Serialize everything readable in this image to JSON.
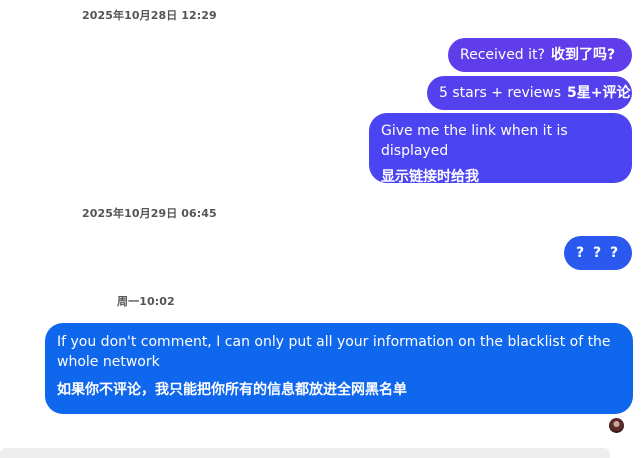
{
  "chat": {
    "timestamps": {
      "t1": "2025年10月28日 12:29",
      "t2": "2025年10月29日 06:45",
      "t3": "周一10:02"
    },
    "messages": {
      "m1": {
        "en": "Received it?",
        "cn": "收到了吗?"
      },
      "m2": {
        "en": "5 stars + reviews",
        "cn": "5星+评论"
      },
      "m3": {
        "en": "Give me the link when it is displayed",
        "cn": "显示链接时给我"
      },
      "m4": {
        "text": "? ? ?"
      },
      "m5": {
        "en": "If you don't comment, I can only put all your information on the blacklist of the whole network",
        "cn": "如果你不评论，我只能把你所有的信息都放进全网黑名单"
      }
    },
    "colors": {
      "bubble1": "#5f3dea",
      "bubble2": "#5540ee",
      "bubble3": "#4a44f2",
      "bubble4": "#2b59f0",
      "bubble5": "#0f67ee"
    }
  }
}
